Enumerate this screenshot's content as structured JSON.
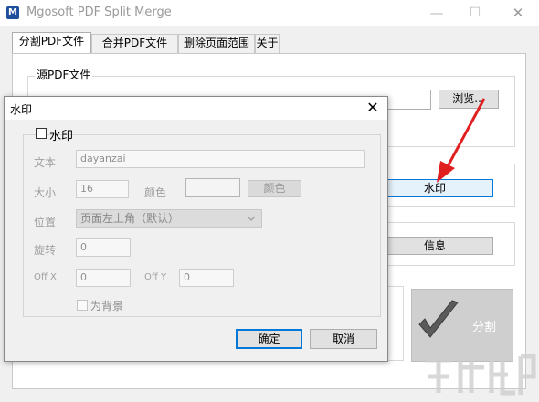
{
  "window": {
    "app_icon": "M",
    "title": "Mgosoft PDF Split Merge",
    "minimize_glyph": "—",
    "maximize_glyph": "☐",
    "close_glyph": "✕"
  },
  "tabs": [
    {
      "label": "分割PDF文件",
      "active": true
    },
    {
      "label": "合并PDF文件",
      "active": false
    },
    {
      "label": "删除页面范围",
      "active": false
    },
    {
      "label": "关于",
      "active": false
    }
  ],
  "main": {
    "source_group_label": "源PDF文件",
    "source_path_value": "",
    "browse_label": "浏览...",
    "watermark_button_label": "水印",
    "info_button_label": "信息",
    "split_button_label": "分割"
  },
  "dialog": {
    "title": "水印",
    "close_glyph": "✕",
    "watermark_checkbox_label": "水印",
    "watermark_checked": false,
    "text_label": "文本",
    "text_value": "dayanzai",
    "size_label": "大小",
    "size_value": "16",
    "color_label": "颜色",
    "color_button_label": "颜色",
    "position_label": "位置",
    "position_value": "页面左上角（默认）",
    "rotate_label": "旋转",
    "rotate_value": "0",
    "offx_label": "Off X",
    "offx_value": "0",
    "offy_label": "Off Y",
    "offy_value": "0",
    "background_checkbox_label": "为背景",
    "background_checked": false,
    "ok_label": "确定",
    "cancel_label": "取消"
  },
  "colors": {
    "accent": "#0078d7",
    "arrow": "#e02020",
    "app_icon_bg": "#1f4e9a"
  },
  "icons": [
    "pdf-app-icon",
    "minimize-icon",
    "maximize-icon",
    "close-icon",
    "checkmark-icon",
    "chevron-down-icon",
    "red-arrow-annotation"
  ]
}
